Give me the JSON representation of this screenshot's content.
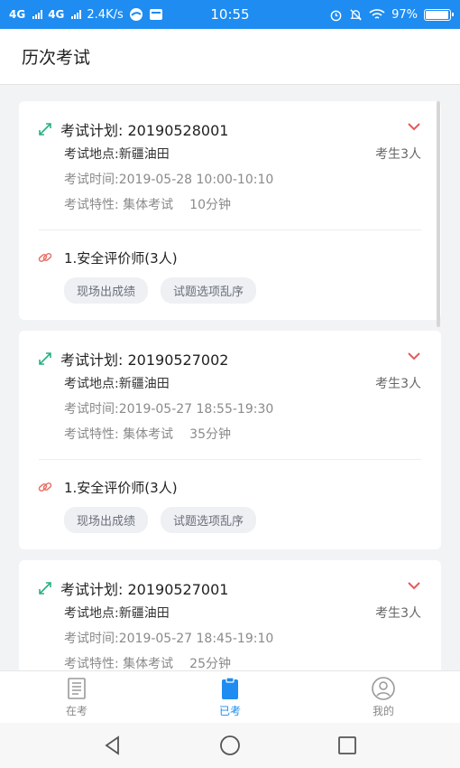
{
  "status_bar": {
    "net1": "4G",
    "net2": "4G",
    "speed": "2.4K/s",
    "time": "10:55",
    "battery": "97%"
  },
  "header": {
    "title": "历次考试"
  },
  "exams": [
    {
      "plan": "考试计划: 20190528001",
      "location": "考试地点:新疆油田",
      "count": "考生3人",
      "time": "考试时间:2019-05-28 10:00-10:10",
      "feature": "考试特性: 集体考试",
      "duration": "10分钟",
      "subject": "1.安全评价师(3人)",
      "tags": [
        "现场出成绩",
        "试题选项乱序"
      ]
    },
    {
      "plan": "考试计划: 20190527002",
      "location": "考试地点:新疆油田",
      "count": "考生3人",
      "time": "考试时间:2019-05-27 18:55-19:30",
      "feature": "考试特性: 集体考试",
      "duration": "35分钟",
      "subject": "1.安全评价师(3人)",
      "tags": [
        "现场出成绩",
        "试题选项乱序"
      ]
    },
    {
      "plan": "考试计划: 20190527001",
      "location": "考试地点:新疆油田",
      "count": "考生3人",
      "time": "考试时间:2019-05-27 18:45-19:10",
      "feature": "考试特性: 集体考试",
      "duration": "25分钟",
      "subject": "",
      "tags": []
    }
  ],
  "bottom_nav": [
    {
      "label": "在考",
      "icon": "document-list-icon",
      "active": false
    },
    {
      "label": "已考",
      "icon": "clipboard-icon",
      "active": true
    },
    {
      "label": "我的",
      "icon": "user-icon",
      "active": false
    }
  ],
  "colors": {
    "accent": "#1e8cf0",
    "expand_icon": "#2bb07f",
    "chevron": "#e45a5a",
    "link_icon": "#e8726a"
  }
}
